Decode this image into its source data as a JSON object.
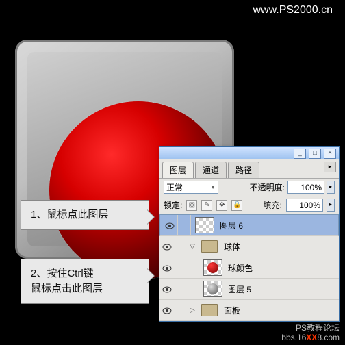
{
  "url": "www.PS2000.cn",
  "watermark_line1": "PS教程论坛",
  "watermark_line2_pre": "bbs.16",
  "watermark_line2_red": "XX",
  "watermark_line2_post": "8.com",
  "callouts": {
    "c1": "1、鼠标点此图层",
    "c2_l1": "2、按住Ctrl键",
    "c2_l2": "鼠标点击此图层"
  },
  "panel": {
    "titlebar": {
      "min": "_",
      "max": "□",
      "close": "×"
    },
    "tabs": {
      "layers": "图层",
      "channels": "通道",
      "paths": "路径",
      "menu": "▸"
    },
    "row1": {
      "blend_value": "正常",
      "opacity_label": "不透明度:",
      "opacity_value": "100%"
    },
    "row2": {
      "lock_label": "锁定:",
      "fill_label": "填充:",
      "fill_value": "100%"
    },
    "layers": {
      "l6": "图层 6",
      "g_ball": "球体",
      "ball_color": "球颜色",
      "l5": "图层 5",
      "g_panel": "面板"
    }
  }
}
